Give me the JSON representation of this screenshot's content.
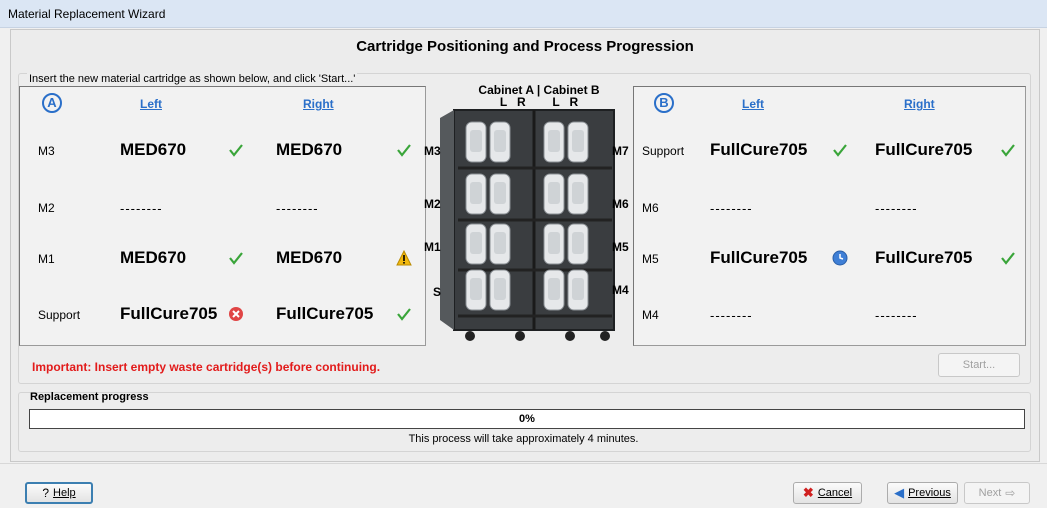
{
  "window": {
    "title": "Material Replacement Wizard"
  },
  "page": {
    "title": "Cartridge Positioning and Process Progression",
    "instruction": "Insert the new material cartridge as shown below, and click 'Start...'",
    "warning": "Important: Insert empty waste cartridge(s) before continuing."
  },
  "cabinet": {
    "header_line1": "Cabinet A | Cabinet B",
    "header_line2": "L   R        L   R",
    "left_slots": [
      "M3",
      "M2",
      "M1",
      "S"
    ],
    "right_slots": [
      "M7",
      "M6",
      "M5",
      "M4"
    ]
  },
  "cabinet_a": {
    "badge": "A",
    "col_left": "Left",
    "col_right": "Right",
    "rows": [
      {
        "label": "M3",
        "left": "MED670",
        "left_status": "ok",
        "right": "MED670",
        "right_status": "ok"
      },
      {
        "label": "M2",
        "left": "--------",
        "left_status": "none",
        "right": "--------",
        "right_status": "none"
      },
      {
        "label": "M1",
        "left": "MED670",
        "left_status": "ok",
        "right": "MED670",
        "right_status": "warning"
      },
      {
        "label": "Support",
        "left": "FullCure705",
        "left_status": "error",
        "right": "FullCure705",
        "right_status": "ok"
      }
    ]
  },
  "cabinet_b": {
    "badge": "B",
    "col_left": "Left",
    "col_right": "Right",
    "rows": [
      {
        "label": "Support",
        "left": "FullCure705",
        "left_status": "ok",
        "right": "FullCure705",
        "right_status": "ok"
      },
      {
        "label": "M6",
        "left": "--------",
        "left_status": "none",
        "right": "--------",
        "right_status": "none"
      },
      {
        "label": "M5",
        "left": "FullCure705",
        "left_status": "pending",
        "right": "FullCure705",
        "right_status": "ok"
      },
      {
        "label": "M4",
        "left": "--------",
        "left_status": "none",
        "right": "--------",
        "right_status": "none"
      }
    ]
  },
  "start_button": {
    "label": "Start..."
  },
  "progress": {
    "title": "Replacement progress",
    "percent_text": "0%",
    "fraction": 0,
    "note": "This process will take approximately 4 minutes."
  },
  "footer": {
    "help_label": "Help",
    "cancel_label": "Cancel",
    "previous_label": "Previous",
    "next_label": "Next"
  },
  "colors": {
    "accent": "#2a6fc9",
    "warning_text": "#e21b1b",
    "ok": "#3aa53a",
    "error": "#e04545",
    "warn_icon": "#f2b90f"
  }
}
